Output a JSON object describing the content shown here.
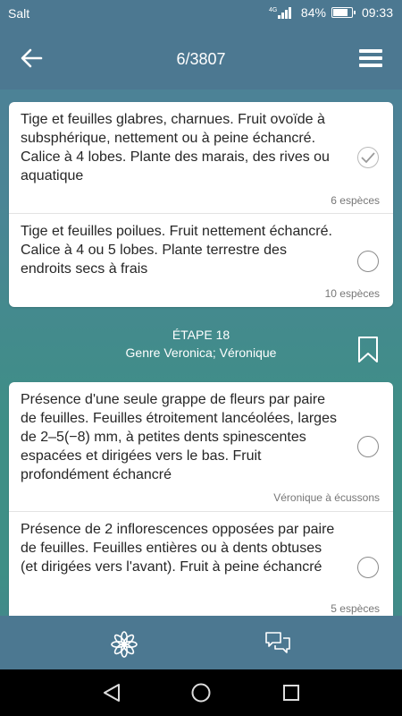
{
  "status_bar": {
    "carrier": "Salt",
    "network": "4G",
    "battery_percent": "84%",
    "battery_level": 0.84,
    "time": "09:33"
  },
  "header": {
    "counter": "6/3807",
    "back_icon": "arrow-left-icon",
    "menu_icon": "hamburger-menu-icon"
  },
  "card1": {
    "options": [
      {
        "text": "Tige et feuilles glabres, charnues. Fruit ovoïde à subsphérique, nettement ou à peine échancré. Calice à 4 lobes. Plante des marais, des rives ou aquatique",
        "meta": "6 espèces",
        "selected": true
      },
      {
        "text": "Tige et feuilles poilues. Fruit nettement échancré. Calice à 4 ou 5 lobes. Plante terrestre des endroits secs à frais",
        "meta": "10 espèces",
        "selected": false
      }
    ]
  },
  "step": {
    "number": "ÉTAPE 18",
    "genre": "Genre Veronica; Véronique",
    "bookmark_icon": "bookmark-icon"
  },
  "card2": {
    "options": [
      {
        "text": "Présence d'une seule grappe de fleurs par paire de feuilles. Feuilles étroitement lancéolées, larges de 2–5(−8) mm, à petites dents spinescentes espacées et dirigées vers le bas. Fruit profondément échancré",
        "meta": "Véronique à écussons",
        "selected": false
      },
      {
        "text": "Présence de 2 inflorescences opposées par paire de feuilles. Feuilles entières ou à dents obtuses (et dirigées vers l'avant). Fruit à peine échancré",
        "meta": "5 espèces",
        "selected": false
      }
    ]
  },
  "bottom_bar": {
    "left_icon": "flower-icon",
    "right_icon": "chat-bubbles-icon"
  },
  "nav_bar": {
    "back": "nav-back-icon",
    "home": "nav-home-icon",
    "recents": "nav-recents-icon"
  },
  "colors": {
    "header_bg": "#4c7891",
    "card_bg": "#ffffff",
    "text": "#262626",
    "meta_text": "#777777"
  }
}
